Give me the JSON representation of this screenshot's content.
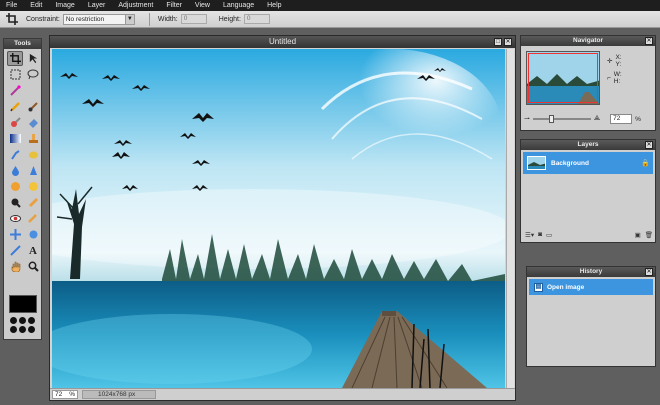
{
  "menu": [
    "File",
    "Edit",
    "Image",
    "Layer",
    "Adjustment",
    "Filter",
    "View",
    "Language",
    "Help"
  ],
  "options": {
    "constraint_label": "Constraint:",
    "constraint_value": "No restriction",
    "width_label": "Width:",
    "width_value": "0",
    "height_label": "Height:",
    "height_value": "0"
  },
  "tools": {
    "title": "Tools",
    "buttons": [
      "crop-icon",
      "move-icon",
      "marquee-icon",
      "lasso-icon",
      "wand-icon",
      "pencil-icon",
      "brush-icon",
      "clone-icon",
      "eraser-icon",
      "gradient-icon",
      "stamp-icon",
      "smudge-icon",
      "sponge-icon",
      "drop-icon",
      "sharpen-icon",
      "dodge-icon",
      "burn-icon",
      "eyedropper-icon",
      "redeye-icon",
      "bloat-icon",
      "drawing-icon",
      "pan-icon",
      "text-icon",
      "hand-icon",
      "zoom-icon"
    ],
    "colors": {
      "foreground": "#000000",
      "background": "#000000"
    }
  },
  "document": {
    "title": "Untitled",
    "zoom": "72",
    "zoom_unit": "%",
    "dimensions": "1024x768 px"
  },
  "navigator": {
    "title": "Navigator",
    "x_label": "X:",
    "y_label": "Y:",
    "w_label": "W:",
    "h_label": "H:",
    "zoom": "72",
    "zoom_unit": "%"
  },
  "layers": {
    "title": "Layers",
    "items": [
      {
        "name": "Background",
        "locked": true
      }
    ]
  },
  "history": {
    "title": "History",
    "items": [
      {
        "name": "Open image"
      }
    ]
  },
  "colors": {
    "selection": "#3d95e0",
    "menubar": "#1e1e1e",
    "workspace": "#5f5f5f"
  }
}
